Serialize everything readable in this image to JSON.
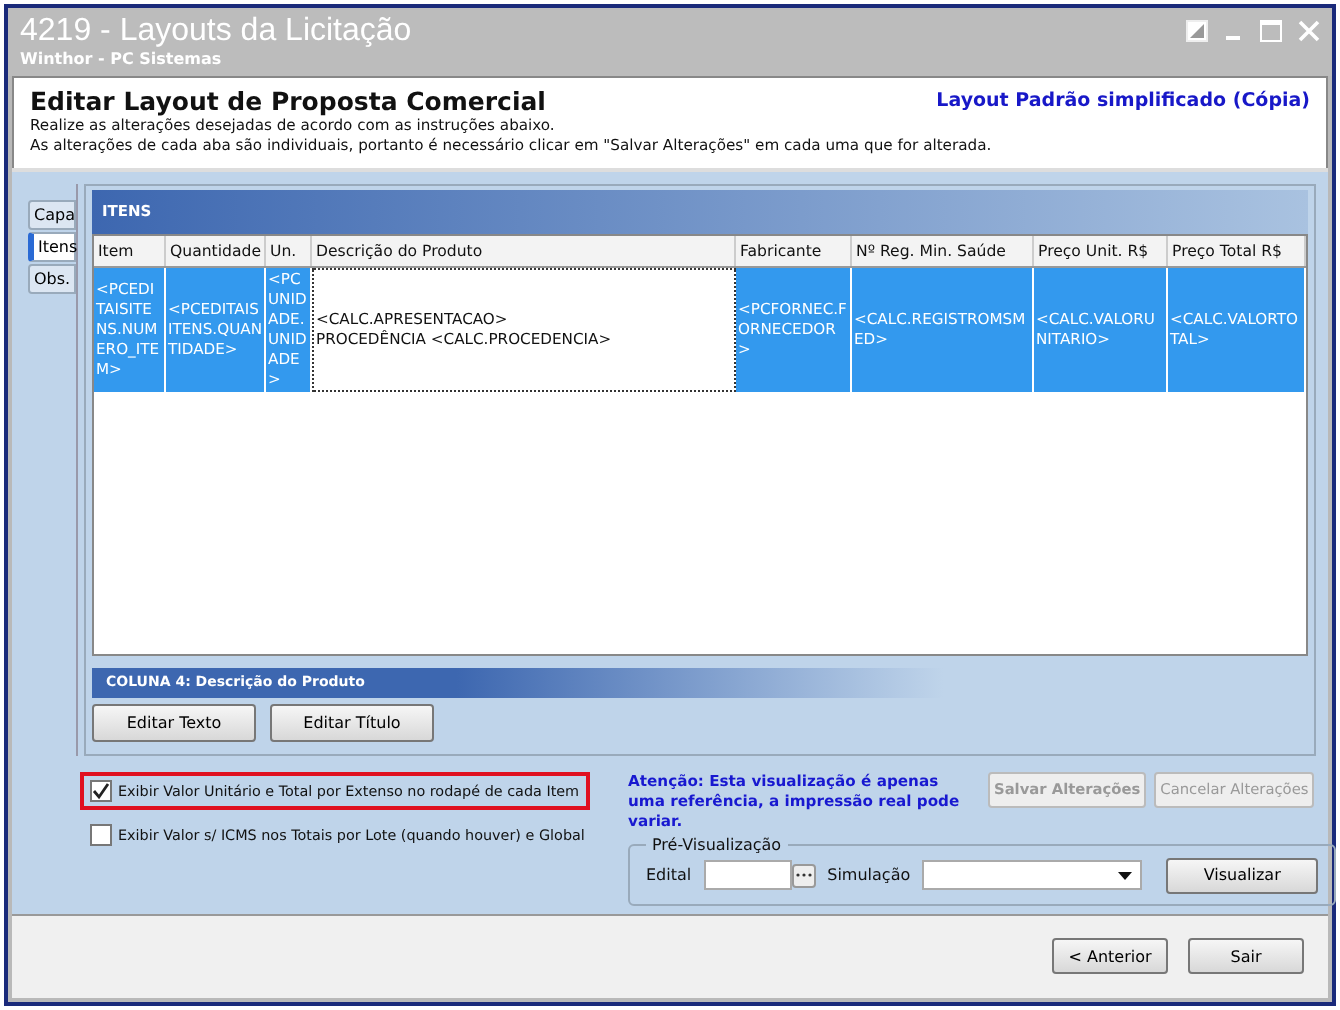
{
  "window": {
    "title": "4219 - Layouts da Licitação",
    "subtitle": "Winthor - PC Sistemas"
  },
  "header": {
    "title": "Editar Layout de Proposta Comercial",
    "layout_name": "Layout Padrão simplificado (Cópia)",
    "instructions": [
      "Realize as alterações desejadas de acordo com as instruções abaixo.",
      "As alterações de cada aba são individuais, portanto é necessário clicar em \"Salvar Alterações\" em cada uma que for alterada."
    ]
  },
  "tabs": [
    {
      "label": "Capa",
      "selected": false
    },
    {
      "label": "Itens",
      "selected": true
    },
    {
      "label": "Obs.",
      "selected": false
    }
  ],
  "items_panel": {
    "title": "ITENS",
    "columns": [
      {
        "heading": "Item",
        "value": [
          "<PCEDITAISITENS.NUMERO_ITEM>"
        ],
        "focused": false
      },
      {
        "heading": "Quantidade",
        "value": [
          "<PCEDITAISITENS.QUANTIDADE>"
        ],
        "focused": false
      },
      {
        "heading": "Un.",
        "value": [
          "<PCUNIDADE.UNIDADE>"
        ],
        "focused": false
      },
      {
        "heading": "Descrição do Produto",
        "value": [
          "<CALC.APRESENTACAO>",
          "PROCEDÊNCIA <CALC.PROCEDENCIA>"
        ],
        "focused": true
      },
      {
        "heading": "Fabricante",
        "value": [
          "<PCFORNEC.FORNECEDOR>"
        ],
        "focused": false
      },
      {
        "heading": "Nº Reg. Min. Saúde",
        "value": [
          "<CALC.REGISTROMSMED>"
        ],
        "focused": false
      },
      {
        "heading": "Preço Unit. R$",
        "value": [
          "<CALC.VALORUNITARIO>"
        ],
        "focused": false
      },
      {
        "heading": "Preço Total R$",
        "value": [
          "<CALC.VALORTOTAL>"
        ],
        "focused": false
      }
    ],
    "column_caption": "COLUNA 4: Descrição do Produto",
    "buttons": [
      "Editar Texto",
      "Editar Título"
    ]
  },
  "options": [
    {
      "label": "Exibir Valor Unitário e Total por Extenso no rodapé de cada Item",
      "checked": true,
      "highlighted": true
    },
    {
      "label": "Exibir Valor s/ ICMS nos Totais por Lote (quando houver) e Global",
      "checked": false,
      "highlighted": false
    }
  ],
  "notice": "Atenção: Esta visualização é apenas uma referência, a impressão real pode variar.",
  "action_buttons": [
    {
      "label": "Salvar Alterações",
      "disabled": true
    },
    {
      "label": "Cancelar Alterações",
      "disabled": true
    }
  ],
  "preview": {
    "title": "Pré-Visualização",
    "edital_label": "Edital",
    "simulacao_label": "Simulação",
    "button": "Visualizar"
  },
  "footer_buttons": [
    "< Anterior",
    "Sair"
  ]
}
